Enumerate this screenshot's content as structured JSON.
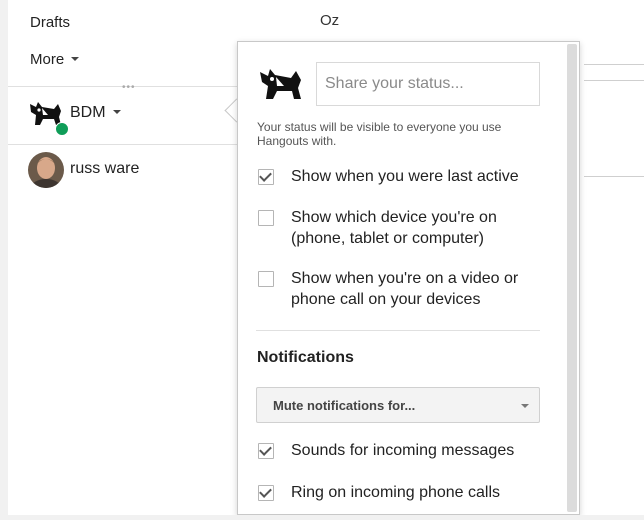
{
  "nav": {
    "drafts_label": "Drafts",
    "more_label": "More"
  },
  "me": {
    "name": "BDM",
    "presence_color": "#0f9d58"
  },
  "contacts": [
    {
      "name": "russ ware"
    }
  ],
  "background": {
    "partial_text": "Oz"
  },
  "status_popup": {
    "input_placeholder": "Share your status...",
    "visibility_note": "Your status will be visible to everyone you use Hangouts with.",
    "options": [
      {
        "label": "Show when you were last active",
        "checked": true
      },
      {
        "label": "Show which device you're on (phone, tablet or computer)",
        "checked": false
      },
      {
        "label": "Show when you're on a video or phone call on your devices",
        "checked": false
      }
    ],
    "notifications": {
      "title": "Notifications",
      "mute_label": "Mute notifications for...",
      "options": [
        {
          "label": "Sounds for incoming messages",
          "checked": true
        },
        {
          "label": "Ring on incoming phone calls",
          "checked": true
        }
      ]
    }
  }
}
